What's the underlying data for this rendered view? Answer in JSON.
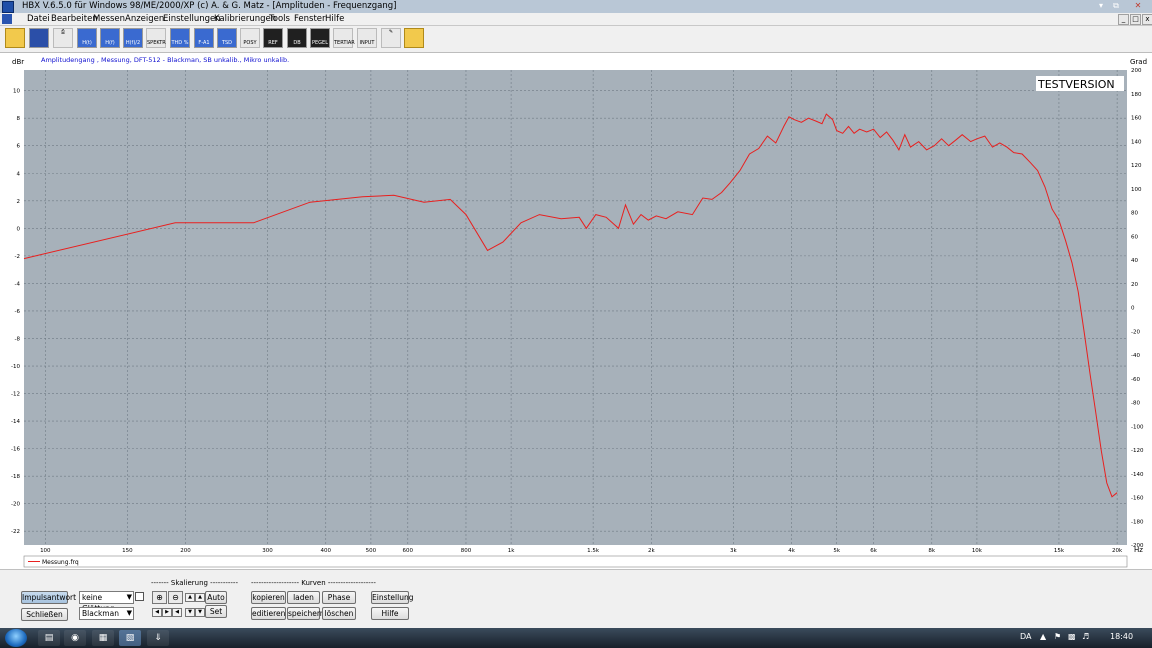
{
  "window": {
    "title": "HBX V.6.5.0   für Windows 98/ME/2000/XP      (c)  A. & G. Matz - [Amplituden - Frequenzgang]"
  },
  "menu": [
    "Datei",
    "Bearbeiten",
    "Messen",
    "Anzeigen",
    "Einstellungen",
    "Kalibrierungen",
    "Tools",
    "Fenster",
    "Hilfe"
  ],
  "toolbar": {
    "labels": [
      "H(t)",
      "H(f)",
      "H(f)/2",
      "SPEKTR",
      "T.F.S",
      "THD %",
      "F-A1",
      "TSD",
      "POSY",
      "REF",
      "DB",
      "PEGEL",
      "TERTIAR",
      "INPUT"
    ]
  },
  "plot": {
    "subtitle": "Amplitudengang , Messung, DFT-512 - Blackman, SB unkalib., Mikro unkalib.",
    "watermark": "TESTVERSION",
    "left_unit": "dBr",
    "right_unit": "Grad",
    "x_unit": "Hz",
    "legend": "Messung.frq"
  },
  "chart_data": {
    "type": "line",
    "title": "",
    "xlabel": "Hz",
    "ylabel": "dBr",
    "y2label": "Grad",
    "xscale": "log",
    "xlim": [
      90,
      21000
    ],
    "ylim": [
      -23,
      11.5
    ],
    "y2lim": [
      -200,
      200
    ],
    "x_ticks": [
      "100",
      "150",
      "200",
      "300",
      "400",
      "500",
      "600",
      "800",
      "1k",
      "1.5k",
      "2k",
      "3k",
      "4k",
      "5k",
      "6k",
      "8k",
      "10k",
      "15k",
      "20k"
    ],
    "y_ticks": [
      "10",
      "8",
      "6",
      "4",
      "2",
      "0",
      "-2",
      "-4",
      "-6",
      "-8",
      "-10",
      "-12",
      "-14",
      "-16",
      "-18",
      "-20",
      "-22"
    ],
    "y2_ticks": [
      "200",
      "180",
      "160",
      "140",
      "120",
      "100",
      "80",
      "60",
      "40",
      "20",
      "0",
      "-20",
      "-40",
      "-60",
      "-80",
      "-100",
      "-120",
      "-140",
      "-160",
      "-180",
      "-200"
    ],
    "grid": true,
    "series": [
      {
        "name": "Messung.frq",
        "color": "#e8201f",
        "x": [
          90,
          190,
          280,
          370,
          480,
          560,
          650,
          740,
          800,
          890,
          960,
          1050,
          1150,
          1280,
          1400,
          1450,
          1520,
          1600,
          1700,
          1760,
          1830,
          1900,
          1970,
          2050,
          2150,
          2280,
          2450,
          2580,
          2700,
          2830,
          2950,
          3100,
          3250,
          3400,
          3550,
          3700,
          3850,
          3950,
          4050,
          4200,
          4350,
          4500,
          4650,
          4750,
          4900,
          5000,
          5150,
          5300,
          5450,
          5600,
          5800,
          6000,
          6200,
          6400,
          6600,
          6800,
          7000,
          7200,
          7500,
          7800,
          8100,
          8400,
          8700,
          9000,
          9300,
          9700,
          10000,
          10400,
          10800,
          11200,
          11600,
          12000,
          12500,
          13000,
          13500,
          14000,
          14500,
          15000,
          15500,
          16000,
          16500,
          17000,
          17500,
          18000,
          18500,
          19000,
          19500,
          20000
        ],
        "values": [
          -2.2,
          0.4,
          0.4,
          1.9,
          2.3,
          2.4,
          1.9,
          2.1,
          1.0,
          -1.6,
          -1.0,
          0.4,
          1.0,
          0.7,
          0.8,
          0.0,
          1.0,
          0.8,
          0.0,
          1.7,
          0.3,
          1.0,
          0.6,
          0.9,
          0.7,
          1.2,
          1.0,
          2.2,
          2.1,
          2.6,
          3.3,
          4.2,
          5.4,
          5.8,
          6.7,
          6.2,
          7.4,
          8.1,
          7.9,
          7.7,
          8.0,
          7.8,
          7.6,
          8.3,
          7.9,
          7.1,
          6.9,
          7.4,
          6.9,
          7.2,
          7.0,
          7.2,
          6.6,
          7.0,
          6.4,
          5.7,
          6.8,
          5.9,
          6.3,
          5.7,
          6.0,
          6.5,
          6.0,
          6.4,
          6.8,
          6.3,
          6.5,
          6.7,
          5.9,
          6.2,
          5.9,
          5.5,
          5.4,
          4.8,
          4.2,
          3.0,
          1.4,
          0.6,
          -0.9,
          -2.5,
          -4.6,
          -7.6,
          -10.6,
          -13.4,
          -16.2,
          -18.5,
          -19.5,
          -19.2
        ]
      }
    ]
  },
  "controls": {
    "impulsantwort": "Impulsantwort",
    "schliessen": "Schließen",
    "smoothing_value": "keine Glättung",
    "window_value": "Blackman",
    "skalierung_label": "------- Skalierung -----------",
    "auto": "Auto",
    "set": "Set",
    "kurven_label": "------------------- Kurven -------------------",
    "kopieren": "kopieren",
    "laden": "laden",
    "phase": "Phase",
    "editieren": "editieren",
    "speichern": "speichern",
    "loeschen": "löschen",
    "einstellung": "Einstellung",
    "hilfe": "Hilfe"
  },
  "taskbar": {
    "language": "DA",
    "clock": "18:40"
  },
  "colors": {
    "plot_bg": "#a7b1ba",
    "curve": "#e8201f",
    "subtitle": "#1010d0"
  }
}
